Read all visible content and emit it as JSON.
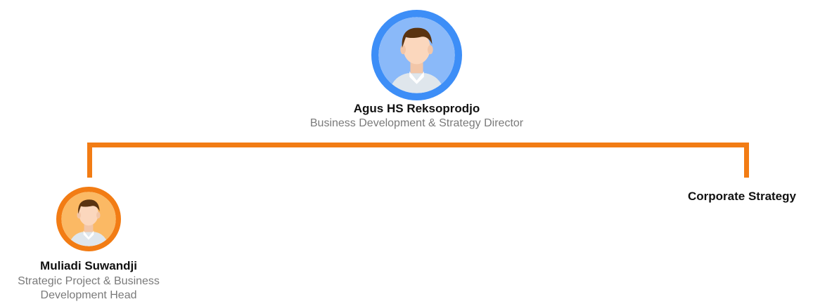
{
  "top_node": {
    "name": "Agus HS Reksoprodjo",
    "role": "Business Development & Strategy Director",
    "avatar_ring_color": "#3d8ef7",
    "avatar_bg_color": "#8ab9f9"
  },
  "child_nodes": [
    {
      "name": "Muliadi Suwandji",
      "role": "Strategic Project & Business Development Head",
      "avatar_ring_color": "#f27c14",
      "avatar_bg_color": "#fbb964"
    },
    {
      "label": "Corporate Strategy"
    }
  ],
  "connector_color": "#f27c14"
}
